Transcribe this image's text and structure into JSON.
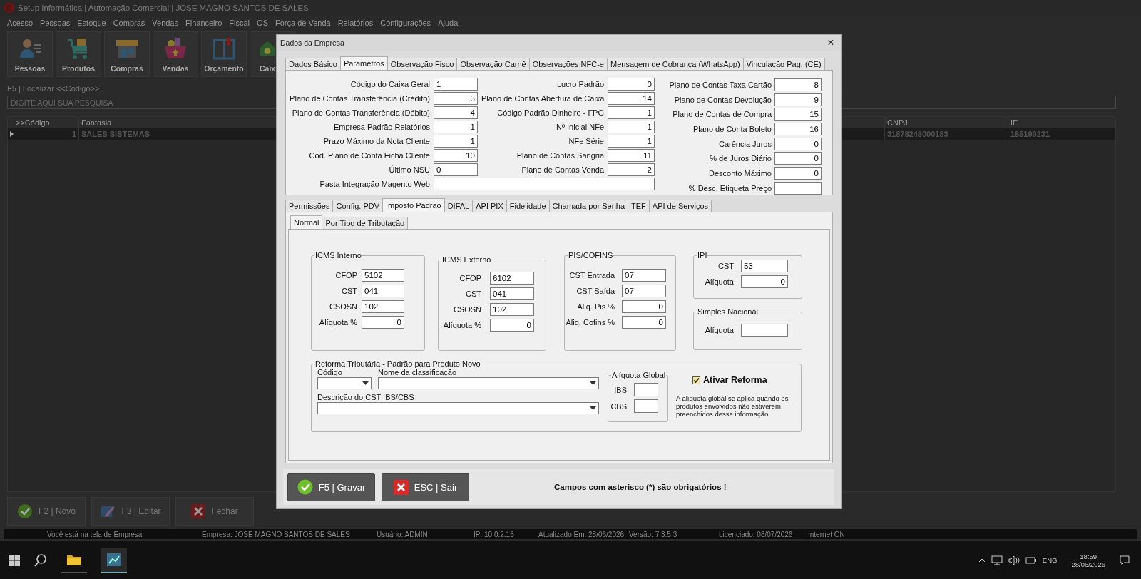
{
  "app": {
    "title": "Setup Informática | Automação Comercial | JOSE MAGNO SANTOS DE SALES"
  },
  "menu": [
    "Acesso",
    "Pessoas",
    "Estoque",
    "Compras",
    "Vendas",
    "Financeiro",
    "Fiscal",
    "OS",
    "Força de Venda",
    "Relatórios",
    "Configurações",
    "Ajuda"
  ],
  "toolbar": [
    "Pessoas",
    "Produtos",
    "Compras",
    "Vendas",
    "Orçamento",
    "Caix"
  ],
  "search": {
    "label": "F5 | Localizar <<Código>>",
    "placeholder": "DIGITE AQUI SUA PESQUISA"
  },
  "grid": {
    "columns": [
      ">>Código",
      "Fantasia",
      "CNPJ",
      "IE"
    ],
    "rows": [
      {
        "cells": [
          "1",
          "SALES SISTEMAS",
          "31878248000183",
          "185190231"
        ],
        "selected": true
      }
    ]
  },
  "bottom_buttons": [
    "F2 | Novo",
    "F3 | Editar",
    "Fechar"
  ],
  "status_bar": [
    "Você está na tela de Empresa",
    "Empresa: JOSE MAGNO SANTOS DE SALES",
    "Usuário: ADMIN",
    "IP: 10.0.2.15",
    "Atualizado Em: 28/06/2026",
    "Versão: 7.3.5.3",
    "Licenciado: 08/07/2026",
    "Internet ON"
  ],
  "taskbar": {
    "language": "ENG",
    "time": "18:59",
    "date": "28/06/2026"
  },
  "dialog": {
    "title": "Dados da Empresa",
    "close": "×",
    "tabs": [
      {
        "label": "Dados Básico",
        "selected": false
      },
      {
        "label": "Parâmetros",
        "selected": true
      },
      {
        "label": "Observação Fisco",
        "selected": false
      },
      {
        "label": "Observação Carnê",
        "selected": false
      },
      {
        "label": "Observações NFC-e",
        "selected": false
      },
      {
        "label": "Mensagem de Cobrança (WhatsApp)",
        "selected": false
      },
      {
        "label": "Vinculação Pag. (CE)",
        "selected": false
      }
    ],
    "params": {
      "col1": [
        {
          "label": "Código do Caixa Geral",
          "value": "1",
          "kind": "code"
        },
        {
          "label": "Plano de Contas Transferência (Crédito)",
          "value": "3",
          "kind": "number"
        },
        {
          "label": "Plano de Contas Transferência (Débito)",
          "value": "4",
          "kind": "number"
        },
        {
          "label": "Empresa Padrão Relatórios",
          "value": "1",
          "kind": "number"
        },
        {
          "label": "Prazo Máximo da Nota Cliente",
          "value": "1",
          "kind": "number"
        },
        {
          "label": "Cód. Plano de Conta Ficha Cliente",
          "value": "10",
          "kind": "number"
        },
        {
          "label": "Último NSU",
          "value": "0",
          "kind": "code"
        }
      ],
      "col2": [
        {
          "label": "Lucro Padrão",
          "value": "0"
        },
        {
          "label": "Plano de Contas Abertura de Caixa",
          "value": "14"
        },
        {
          "label": "Código Padrão Dinheiro - FPG",
          "value": "1"
        },
        {
          "label": "Nº Inicial NFe",
          "value": "1"
        },
        {
          "label": "NFe Série",
          "value": "1"
        },
        {
          "label": "Plano de Contas Sangria",
          "value": "11"
        },
        {
          "label": "Plano de Contas Venda",
          "value": "2"
        }
      ],
      "col3": [
        {
          "label": "Plano de Contas Taxa Cartão",
          "value": "8"
        },
        {
          "label": "Plano de Contas Devolução",
          "value": "9"
        },
        {
          "label": "Plano de Contas de Compra",
          "value": "15"
        },
        {
          "label": "Plano de Conta Boleto",
          "value": "16"
        },
        {
          "label": "Carência Juros",
          "value": "0"
        },
        {
          "label": "% de Juros Diário",
          "value": "0"
        },
        {
          "label": "Desconto Máximo",
          "value": "0"
        },
        {
          "label": "% Desc. Etiqueta Preço"
        }
      ],
      "pasta": {
        "label": "Pasta Integração Magento Web"
      }
    },
    "sub_tabs": [
      {
        "label": "Permissões",
        "selected": false
      },
      {
        "label": "Config. PDV",
        "selected": false
      },
      {
        "label": "Imposto Padrão",
        "selected": true
      },
      {
        "label": "DIFAL",
        "selected": false
      },
      {
        "label": "API PIX",
        "selected": false
      },
      {
        "label": "Fidelidade",
        "selected": false
      },
      {
        "label": "Chamada por Senha",
        "selected": false
      },
      {
        "label": "TEF",
        "selected": false
      },
      {
        "label": "API de Serviços",
        "selected": false
      }
    ],
    "inner_tabs": [
      {
        "label": "Normal",
        "selected": true
      },
      {
        "label": "Por Tipo de Tributação",
        "selected": false
      }
    ],
    "groups": [
      {
        "title": "ICMS Interno",
        "fields": [
          {
            "label": "CFOP",
            "value": "5102",
            "kind": "code"
          },
          {
            "label": "CST",
            "value": "041",
            "kind": "code"
          },
          {
            "label": "CSOSN",
            "value": "102",
            "kind": "code"
          },
          {
            "label": "Alíquota %",
            "value": "0",
            "kind": "number"
          }
        ]
      },
      {
        "title": "ICMS Externo",
        "fields": [
          {
            "label": "CFOP",
            "value": "6102",
            "kind": "code"
          },
          {
            "label": "CST",
            "value": "041",
            "kind": "code"
          },
          {
            "label": "CSOSN",
            "value": "102",
            "kind": "code"
          },
          {
            "label": "Alíquota %",
            "value": "0",
            "kind": "number"
          }
        ]
      },
      {
        "title": "PIS/COFINS",
        "fields": [
          {
            "label": "CST Entrada",
            "value": "07",
            "kind": "code"
          },
          {
            "label": "CST Saída",
            "value": "07",
            "kind": "code"
          },
          {
            "label": "Aliq. Pis %",
            "value": "0",
            "kind": "number"
          },
          {
            "label": "Aliq. Cofins %",
            "value": "0",
            "kind": "number"
          }
        ]
      },
      {
        "title": "IPI",
        "fields": [
          {
            "label": "CST",
            "value": "53",
            "kind": "code"
          },
          {
            "label": "Alíquota",
            "value": "0",
            "kind": "number"
          }
        ]
      },
      {
        "title": "Simples Nacional",
        "fields": [
          {
            "label": "Alíquota"
          }
        ]
      }
    ],
    "reforma": {
      "title": "Reforma Tributária - Padrão para Produto Novo",
      "codigo_label": "Código",
      "nome_label": "Nome da classificação",
      "descricao_label": "Descrição do CST IBS/CBS",
      "aliquota_global": {
        "title": "Alíquota Global",
        "fields": [
          {
            "label": "IBS"
          },
          {
            "label": "CBS"
          }
        ]
      },
      "checkbox": {
        "label": "Ativar Reforma",
        "checked": true
      },
      "note": "A alíquota global se aplica quando os produtos envolvidos não estiverem preenchidos dessa informação."
    },
    "buttons": [
      {
        "label": "F5 | Gravar",
        "kind": "save"
      },
      {
        "label": "ESC | Sair",
        "kind": "exit"
      }
    ],
    "note": "Campos com asterisco (*) são obrigatórios !"
  }
}
